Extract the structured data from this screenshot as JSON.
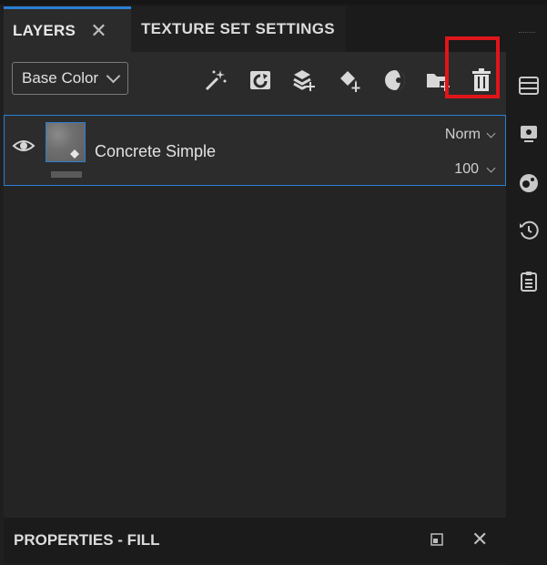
{
  "tabs": {
    "layers_label": "LAYERS",
    "layers_close": "✕",
    "texture_set_label": "TEXTURE SET SETTINGS"
  },
  "toolbar": {
    "channel_dropdown_value": "Base Color",
    "icons": [
      "magic-wand-icon",
      "add-layer-icon",
      "add-stack-icon",
      "add-fill-icon",
      "mask-icon",
      "add-folder-icon",
      "trash-icon"
    ]
  },
  "layer": {
    "name": "Concrete Simple",
    "blend_mode": "Norm",
    "opacity": "100"
  },
  "properties": {
    "title": "PROPERTIES - FILL",
    "close": "✕"
  },
  "colors": {
    "accent": "#2a7fd4",
    "highlight": "#e0151a",
    "panel_bg": "#242424"
  }
}
